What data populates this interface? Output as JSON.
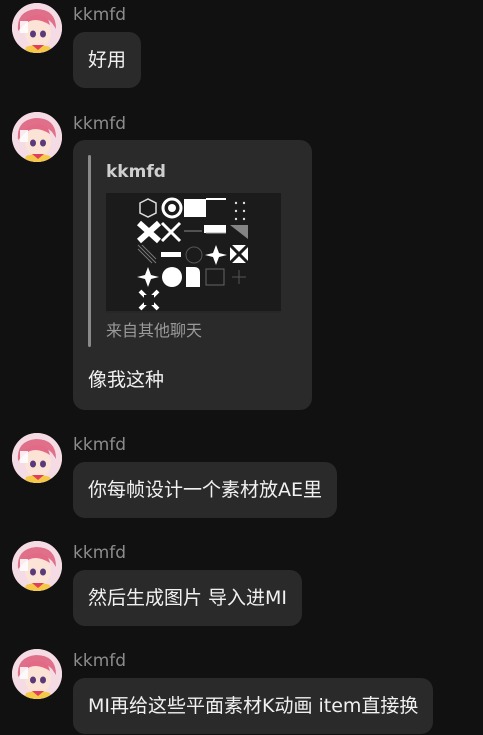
{
  "messages": [
    {
      "sender": "kkmfd",
      "text": "好用"
    },
    {
      "sender": "kkmfd",
      "quote": {
        "sender": "kkmfd",
        "source": "来自其他聊天"
      },
      "text": "像我这种"
    },
    {
      "sender": "kkmfd",
      "text": "你每帧设计一个素材放AE里"
    },
    {
      "sender": "kkmfd",
      "text": "然后生成图片 导入进MI"
    },
    {
      "sender": "kkmfd",
      "text": "MI再给这些平面素材K动画 item直接换"
    }
  ],
  "colors": {
    "background": "#111112",
    "bubble": "#2a2a2b",
    "sender": "#8c8c8c",
    "text": "#f1f1f1"
  },
  "icons": {
    "avatar": "anime-girl-avatar"
  }
}
